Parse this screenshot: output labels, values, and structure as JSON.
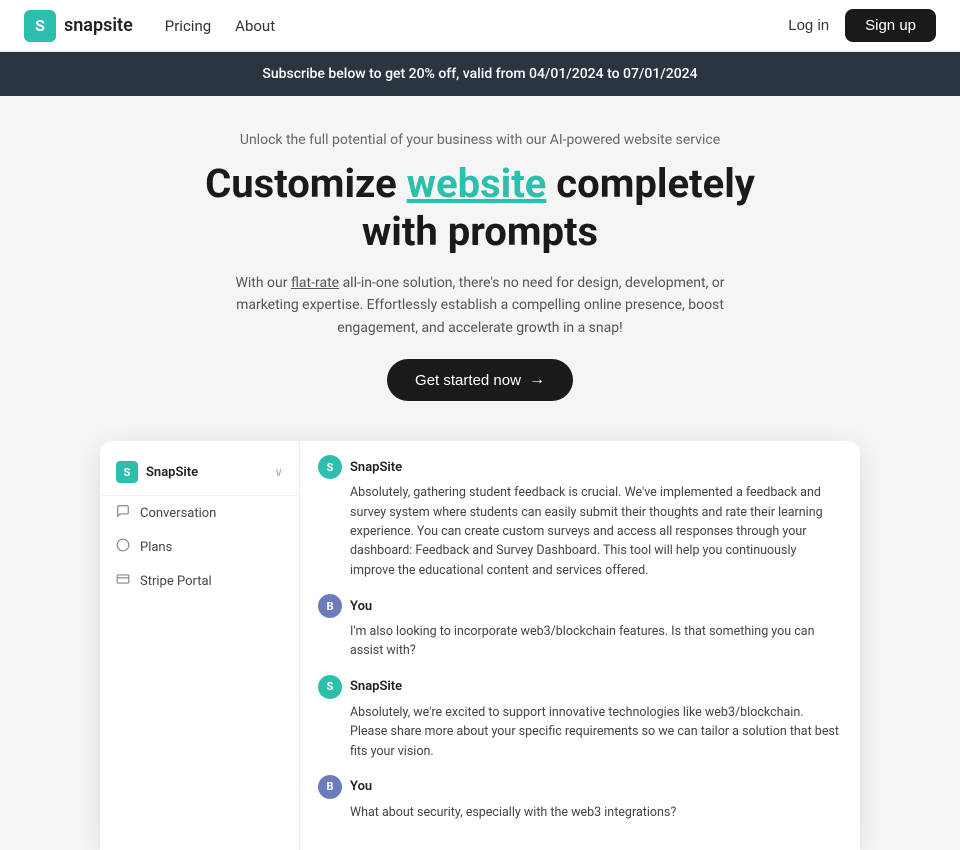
{
  "navbar": {
    "logo_letter": "S",
    "logo_text": "snapsite",
    "nav_links": [
      {
        "label": "Pricing",
        "id": "pricing"
      },
      {
        "label": "About",
        "id": "about"
      }
    ],
    "login_label": "Log in",
    "signup_label": "Sign up"
  },
  "banner": {
    "text": "Subscribe below to get 20% off, valid from 04/01/2024 to 07/01/2024"
  },
  "hero": {
    "subtitle": "Unlock the full potential of your business with our AI-powered website service",
    "title_before": "Customize ",
    "title_highlight": "website",
    "title_after": " completely\nwith prompts",
    "description": "With our flat-rate all-in-one solution, there's no need for design, development, or marketing expertise. Effortlessly establish a compelling online presence, boost engagement, and accelerate growth in a snap!",
    "cta_label": "Get started now",
    "cta_arrow": "→"
  },
  "sidebar": {
    "brand_name": "SnapSite",
    "brand_letter": "S",
    "chevron": "∨",
    "items": [
      {
        "label": "Conversation",
        "icon": "💬",
        "id": "conversation"
      },
      {
        "label": "Plans",
        "icon": "◇",
        "id": "plans"
      },
      {
        "label": "Stripe Portal",
        "icon": "☰",
        "id": "stripe-portal"
      }
    ]
  },
  "chat": {
    "messages": [
      {
        "sender": "SnapSite",
        "avatar_type": "snap",
        "avatar_letter": "S",
        "text": "Absolutely, gathering student feedback is crucial. We've implemented a feedback and survey system where students can easily submit their thoughts and rate their learning experience. You can create custom surveys and access all responses through your dashboard: Feedback and Survey Dashboard. This tool will help you continuously improve the educational content and services offered."
      },
      {
        "sender": "You",
        "avatar_type": "user",
        "avatar_letter": "B",
        "text": "I'm also looking to incorporate web3/blockchain features. Is that something you can assist with?"
      },
      {
        "sender": "SnapSite",
        "avatar_type": "snap",
        "avatar_letter": "S",
        "text": "Absolutely, we're excited to support innovative technologies like web3/blockchain. Please share more about your specific requirements so we can tailor a solution that best fits your vision."
      },
      {
        "sender": "You",
        "avatar_type": "user",
        "avatar_letter": "B",
        "text": "What about security, especially with the web3 integrations?"
      }
    ]
  },
  "colors": {
    "teal": "#2dbfad",
    "dark": "#1a1a1a",
    "banner_bg": "#2a3540"
  }
}
